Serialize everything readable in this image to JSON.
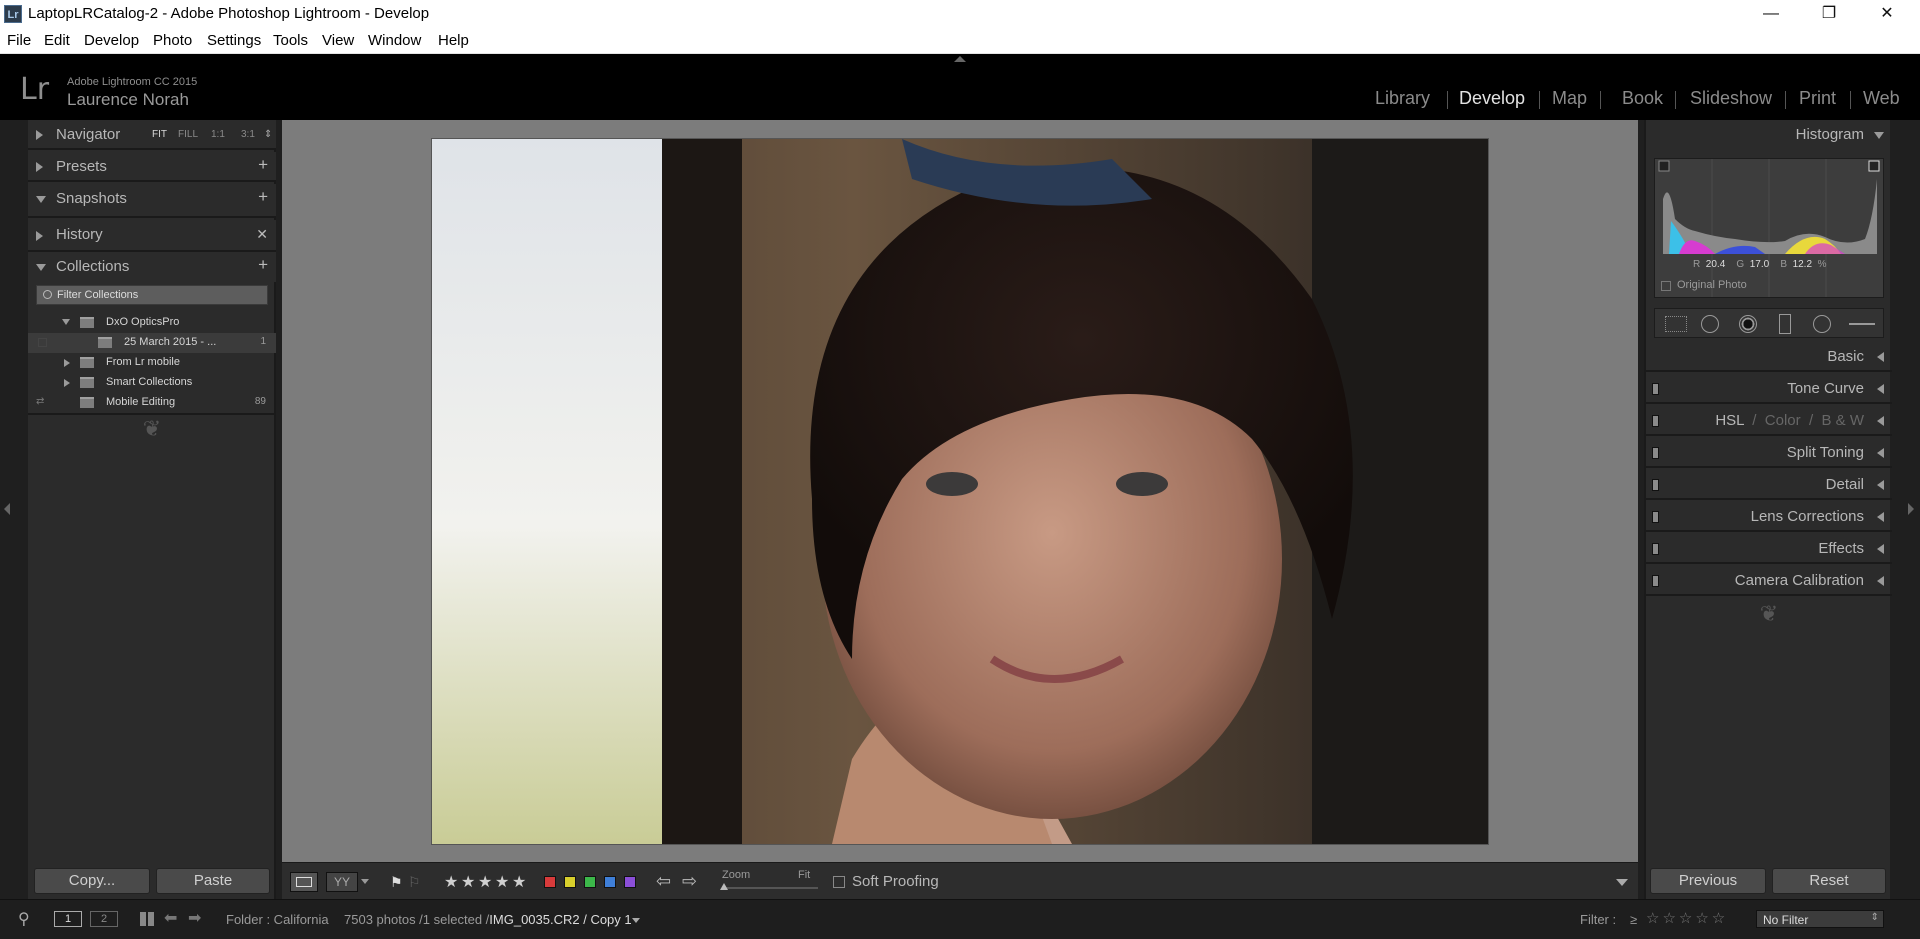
{
  "window": {
    "app_icon": "Lr",
    "title": "LaptopLRCatalog-2 - Adobe Photoshop Lightroom - Develop",
    "minimize": "—",
    "maximize": "❐",
    "close": "✕"
  },
  "menu": [
    "File",
    "Edit",
    "Develop",
    "Photo",
    "Settings",
    "Tools",
    "View",
    "Window",
    "Help"
  ],
  "identity": {
    "logo": "Lr",
    "app_name": "Adobe Lightroom CC 2015",
    "user": "Laurence Norah"
  },
  "modules": [
    {
      "label": "Library",
      "active": false
    },
    {
      "label": "Develop",
      "active": true
    },
    {
      "label": "Map",
      "active": false
    },
    {
      "label": "Book",
      "active": false
    },
    {
      "label": "Slideshow",
      "active": false
    },
    {
      "label": "Print",
      "active": false
    },
    {
      "label": "Web",
      "active": false
    }
  ],
  "left_panel": {
    "navigator": {
      "label": "Navigator",
      "options": [
        "FIT",
        "FILL",
        "1:1",
        "3:1"
      ],
      "active_option": "FIT"
    },
    "presets": {
      "label": "Presets"
    },
    "snapshots": {
      "label": "Snapshots"
    },
    "history": {
      "label": "History"
    },
    "collections": {
      "label": "Collections",
      "filter_placeholder": "Filter Collections",
      "items": [
        {
          "name": "DxO OpticsPro",
          "count": "",
          "expanded": true,
          "level": 0
        },
        {
          "name": "25 March 2015 - ...",
          "count": "1",
          "expanded": false,
          "level": 1
        },
        {
          "name": "From Lr mobile",
          "count": "",
          "expanded": false,
          "level": 0
        },
        {
          "name": "Smart Collections",
          "count": "",
          "expanded": false,
          "level": 0
        },
        {
          "name": "Mobile Editing",
          "count": "89",
          "expanded": false,
          "level": 0
        }
      ]
    },
    "copy_label": "Copy...",
    "paste_label": "Paste"
  },
  "toolbar": {
    "zoom_label": "Zoom",
    "zoom_value": "Fit",
    "soft_proofing": "Soft Proofing",
    "stars": [
      "★",
      "★",
      "★",
      "★",
      "★"
    ],
    "colors": [
      "#d83b3b",
      "#d8cf2c",
      "#3cb84a",
      "#3f7fd8",
      "#8b4fd8"
    ]
  },
  "right_panel": {
    "histogram": {
      "label": "Histogram",
      "r_label": "R",
      "r_value": "20.4",
      "g_label": "G",
      "g_value": "17.0",
      "b_label": "B",
      "b_value": "12.2",
      "pct": "%",
      "original_photo": "Original Photo"
    },
    "panels": [
      {
        "label": "Basic",
        "switch": false
      },
      {
        "label": "Tone Curve",
        "switch": true
      },
      {
        "label": "HSL",
        "sub": [
          "Color",
          "B & W"
        ],
        "switch": true
      },
      {
        "label": "Split Toning",
        "switch": true
      },
      {
        "label": "Detail",
        "switch": true
      },
      {
        "label": "Lens Corrections",
        "switch": true
      },
      {
        "label": "Effects",
        "switch": true
      },
      {
        "label": "Camera Calibration",
        "switch": true
      }
    ],
    "previous_label": "Previous",
    "reset_label": "Reset"
  },
  "filmstrip": {
    "page1": "1",
    "page2": "2",
    "folder": "Folder : California",
    "info": "7503 photos /1 selected /",
    "filename": "IMG_0035.CR2 / Copy 1",
    "filter_label": "Filter :",
    "filter_symbol": "≥",
    "filter_value": "No Filter"
  }
}
